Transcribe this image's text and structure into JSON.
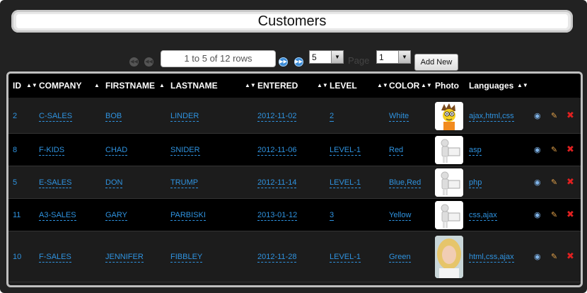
{
  "title": "Customers",
  "pager": {
    "rows_info": "1 to 5 of 12 rows",
    "page_size": "5",
    "page_label": "Page",
    "page_number": "1",
    "add_label": "Add New"
  },
  "columns": [
    {
      "label": "ID"
    },
    {
      "label": "COMPANY"
    },
    {
      "label": "FIRSTNAME"
    },
    {
      "label": "LASTNAME"
    },
    {
      "label": "ENTERED"
    },
    {
      "label": "LEVEL"
    },
    {
      "label": "COLOR"
    },
    {
      "label": "Photo"
    },
    {
      "label": "Languages"
    }
  ],
  "rows": [
    {
      "id": "2",
      "company": "C-SALES",
      "firstname": "BOB",
      "lastname": "LINDER",
      "entered": "2012-11-02",
      "level": "2",
      "color": "White",
      "photo": "cartoon-avatar",
      "languages": "ajax,html,css"
    },
    {
      "id": "8",
      "company": "F-KIDS",
      "firstname": "CHAD",
      "lastname": "SNIDER",
      "entered": "2012-11-06",
      "level": "LEVEL-1",
      "color": "Red",
      "photo": "placeholder-figure",
      "languages": "asp"
    },
    {
      "id": "5",
      "company": "E-SALES",
      "firstname": "DON",
      "lastname": "TRUMP",
      "entered": "2012-11-14",
      "level": "LEVEL-1",
      "color": "Blue,Red",
      "photo": "placeholder-figure",
      "languages": "php"
    },
    {
      "id": "11",
      "company": "A3-SALES",
      "firstname": "GARY",
      "lastname": "PARBISKI",
      "entered": "2013-01-12",
      "level": "3",
      "color": "Yellow",
      "photo": "placeholder-figure",
      "languages": "css,ajax"
    },
    {
      "id": "10",
      "company": "F-SALES",
      "firstname": "JENNIFER",
      "lastname": "FIBBLEY",
      "entered": "2012-11-28",
      "level": "LEVEL-1",
      "color": "Green",
      "photo": "portrait-photo",
      "languages": "html,css,ajax"
    }
  ],
  "icons": {
    "first": "first-page-icon",
    "prev": "prev-page-icon",
    "next": "next-page-icon",
    "last": "last-page-icon",
    "view": "view-icon",
    "edit": "edit-pencil-icon",
    "delete": "delete-x-icon"
  },
  "colors": {
    "link": "#2f93e0",
    "header_bg": "#000000",
    "frame_bg": "#222222",
    "delete": "#e02020"
  }
}
